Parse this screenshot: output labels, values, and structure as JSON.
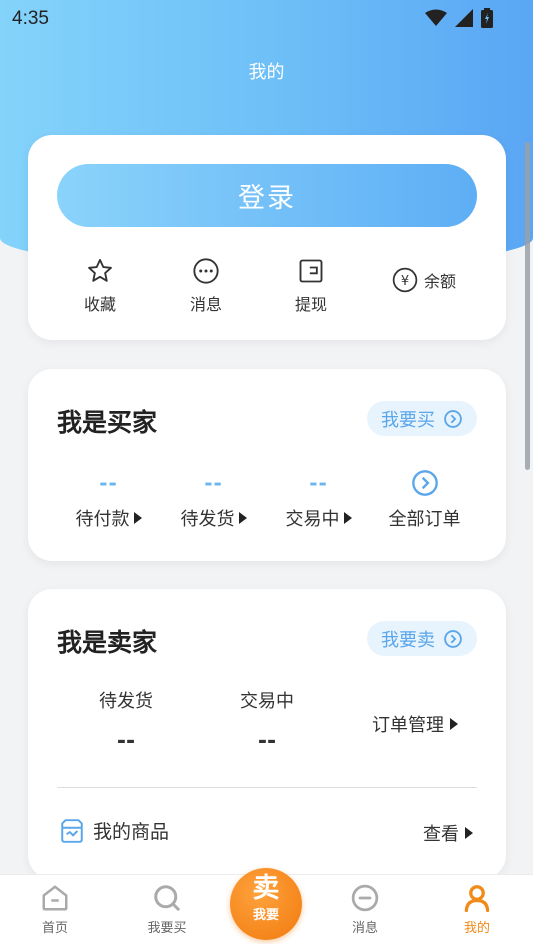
{
  "status_bar": {
    "time": "4:35",
    "icons": [
      "wifi-icon",
      "signal-icon",
      "battery-icon"
    ]
  },
  "header": {
    "title": "我的"
  },
  "login_card": {
    "login_label": "登录",
    "quick_items": [
      {
        "label": "收藏",
        "icon": "star-icon"
      },
      {
        "label": "消息",
        "icon": "message-icon"
      },
      {
        "label": "提现",
        "icon": "wallet-icon"
      }
    ],
    "balance": {
      "symbol": "¥",
      "label": "余额"
    }
  },
  "buyer": {
    "title": "我是买家",
    "action_label": "我要买",
    "stats": [
      {
        "value": "--",
        "label": "待付款"
      },
      {
        "value": "--",
        "label": "待发货"
      },
      {
        "value": "--",
        "label": "交易中"
      }
    ],
    "all_orders_label": "全部订单"
  },
  "seller": {
    "title": "我是卖家",
    "action_label": "我要卖",
    "stats": [
      {
        "value": "--",
        "label": "待发货"
      },
      {
        "value": "--",
        "label": "交易中"
      }
    ],
    "order_manage_label": "订单管理",
    "goods_label": "我的商品",
    "view_label": "查看"
  },
  "tabbar": {
    "tabs": [
      {
        "label": "首页",
        "icon": "home-icon"
      },
      {
        "label": "我要买",
        "icon": "search-icon"
      },
      {
        "label": "消息",
        "icon": "chat-icon"
      },
      {
        "label": "我的",
        "icon": "user-icon"
      }
    ],
    "sell_button": {
      "big": "卖",
      "small": "我要"
    }
  },
  "colors": {
    "accent_blue": "#5aa6f4",
    "accent_orange": "#f08a18"
  }
}
